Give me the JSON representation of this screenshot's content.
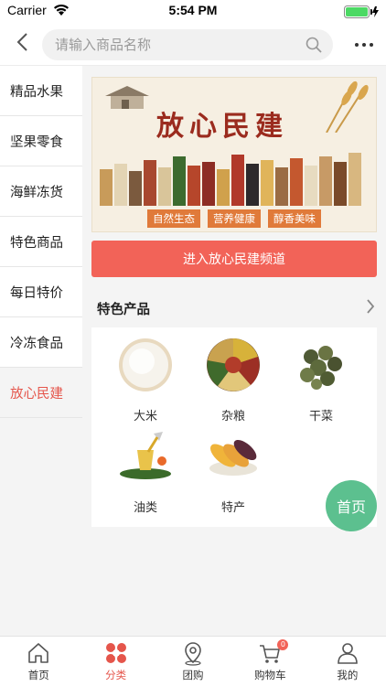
{
  "status_bar": {
    "carrier": "Carrier",
    "time": "5:54 PM"
  },
  "header": {
    "search_placeholder": "请输入商品名称",
    "back_icon": "chevron-left-icon",
    "search_icon": "search-icon",
    "more_icon": "more-dots-icon"
  },
  "sidebar": {
    "items": [
      {
        "label": "精品水果"
      },
      {
        "label": "坚果零食"
      },
      {
        "label": "海鲜冻货"
      },
      {
        "label": "特色商品"
      },
      {
        "label": "每日特价"
      },
      {
        "label": "冷冻食品"
      },
      {
        "label": "放心民建",
        "active": true
      }
    ]
  },
  "banner": {
    "title": "放心民建",
    "tags": [
      "自然生态",
      "营养健康",
      "醇香美味"
    ]
  },
  "channel_button": {
    "label": "进入放心民建频道"
  },
  "section": {
    "title": "特色产品"
  },
  "products": [
    {
      "label": "大米",
      "icon": "rice-icon"
    },
    {
      "label": "杂粮",
      "icon": "grains-icon"
    },
    {
      "label": "干菜",
      "icon": "dried-vegetable-icon"
    },
    {
      "label": "油类",
      "icon": "oil-icon"
    },
    {
      "label": "特产",
      "icon": "corn-specialty-icon"
    }
  ],
  "fab": {
    "label": "首页"
  },
  "tabbar": {
    "items": [
      {
        "label": "首页",
        "icon": "home-icon"
      },
      {
        "label": "分类",
        "icon": "category-icon",
        "active": true
      },
      {
        "label": "团购",
        "icon": "location-icon"
      },
      {
        "label": "购物车",
        "icon": "cart-icon",
        "badge": "0"
      },
      {
        "label": "我的",
        "icon": "user-icon"
      }
    ]
  },
  "colors": {
    "accent": "#e5554b",
    "button": "#f26358",
    "fab": "#5cc08f",
    "banner_title": "#9b2b1e"
  }
}
